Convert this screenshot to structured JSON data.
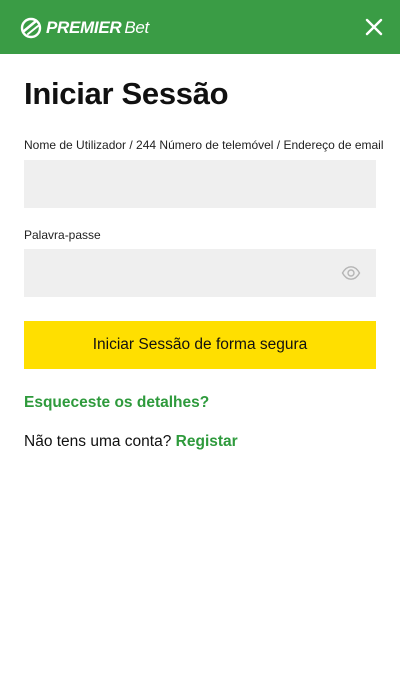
{
  "header": {
    "logo_primary": "PREMIER",
    "logo_secondary": "Bet",
    "logo_icon": "premierbet-logo-icon",
    "close_icon": "close-icon",
    "background_color": "#3a9c45"
  },
  "login": {
    "title": "Iniciar Sessão",
    "username_label": "Nome de Utilizador / 244 Número de telemóvel / Endereço de email",
    "username_value": "",
    "password_label": "Palavra-passe",
    "password_value": "",
    "password_toggle_icon": "eye-icon",
    "submit_label": "Iniciar Sessão de forma segura",
    "submit_color": "#ffdf00",
    "forgot_label": "Esqueceste os detalhes?",
    "no_account_text": "Não tens uma conta?",
    "register_label": "Registar",
    "link_color": "#2e9a3c"
  }
}
